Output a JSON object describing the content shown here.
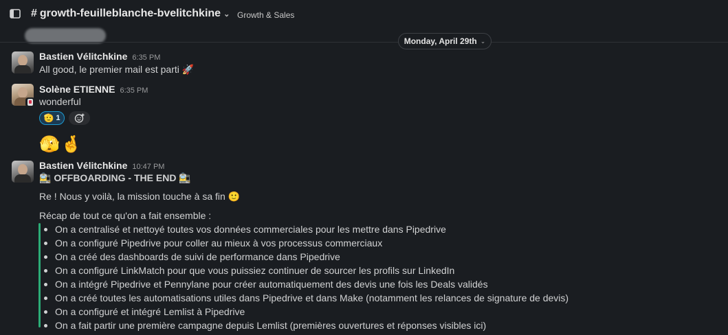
{
  "header": {
    "channel_hash": "#",
    "channel_name": "growth-feuilleblanche-bvelitchkine",
    "channel_chevron": "⌄",
    "channel_description": "Growth & Sales"
  },
  "date_divider": {
    "label": "Monday, April 29th",
    "chevron": "⌄"
  },
  "messages": [
    {
      "author": "Bastien Vélitchkine",
      "time": "6:35 PM",
      "text": "All good, le premier mail est parti",
      "emoji": "🚀"
    },
    {
      "author": "Solène ETIENNE",
      "time": "6:35 PM",
      "text": "wonderful",
      "reaction": {
        "emoji": "🫡",
        "count": "1"
      },
      "big_emojis": [
        "🫣",
        "🤞"
      ]
    },
    {
      "author": "Bastien Vélitchkine",
      "time": "10:47 PM",
      "title_emoji": "🚉",
      "title": "OFFBOARDING - THE END",
      "line2": "Re ! Nous y voilà, la mission touche à sa fin",
      "line2_emoji": "🙂",
      "line3": "Récap de tout ce qu'on a fait ensemble :",
      "bullets": [
        "On a centralisé et nettoyé toutes vos données commerciales pour les mettre dans Pipedrive",
        "On a configuré Pipedrive pour coller au mieux à vos processus commerciaux",
        "On a créé des dashboards de suivi de performance dans Pipedrive",
        "On a configuré LinkMatch pour que vous puissiez continuer de sourcer les profils sur LinkedIn",
        "On a intégré Pipedrive et Pennylane pour créer automatiquement des devis une fois les Deals validés",
        "On a créé toutes les automatisations utiles dans Pipedrive et dans Make (notamment les relances de signature de devis)",
        "On a configuré et intégré Lemlist à Pipedrive",
        "On a fait partir une première campagne depuis Lemlist (premières ouvertures et réponses visibles ici)"
      ]
    }
  ],
  "colors": {
    "background": "#1a1d21",
    "quote_bar": "#2bac76",
    "reaction_border": "#1d9bd1"
  }
}
